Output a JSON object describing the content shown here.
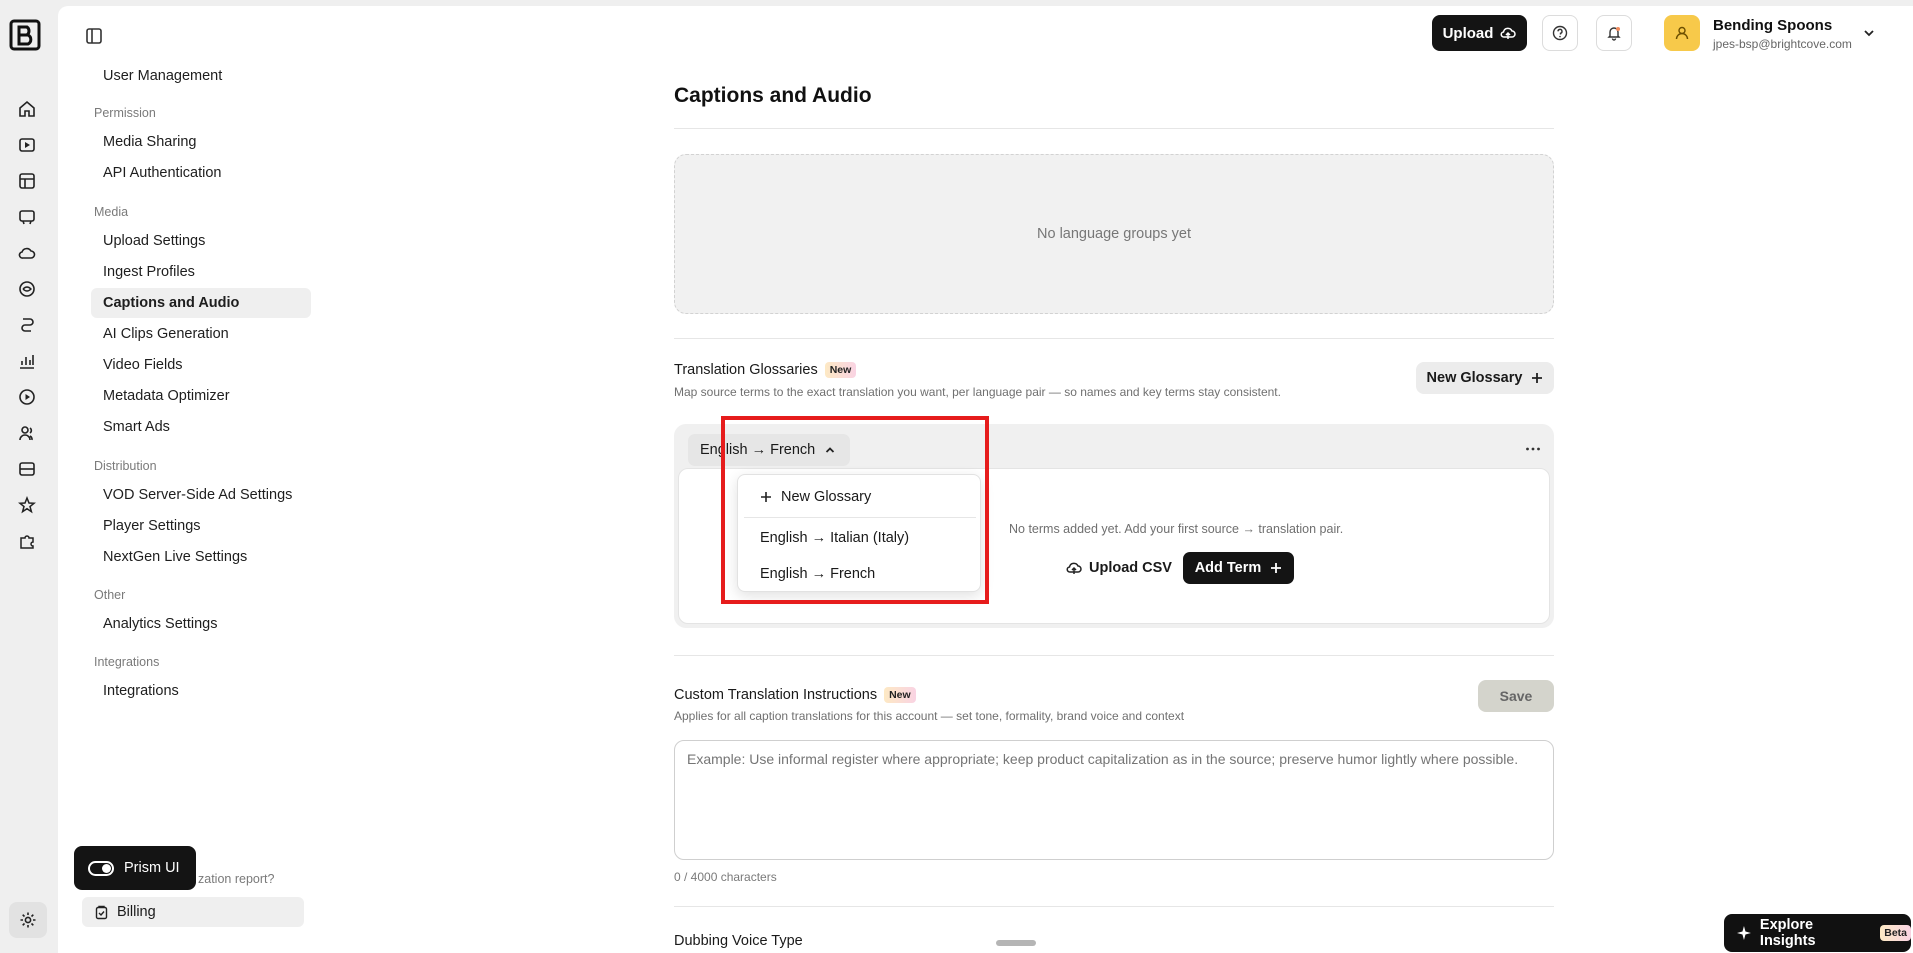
{
  "topbar": {
    "upload_label": "Upload",
    "account_name": "Bending Spoons",
    "account_email": "jpes-bsp@brightcove.com"
  },
  "settings_nav": {
    "partial_top_item": "User Management",
    "categories": {
      "permission": "Permission",
      "media": "Media",
      "distribution": "Distribution",
      "other": "Other",
      "integrations": "Integrations"
    },
    "items": {
      "media_sharing": "Media Sharing",
      "api_authentication": "API Authentication",
      "upload_settings": "Upload Settings",
      "ingest_profiles": "Ingest Profiles",
      "captions_and_audio": "Captions and Audio",
      "ai_clips_generation": "AI Clips Generation",
      "video_fields": "Video Fields",
      "metadata_optimizer": "Metadata Optimizer",
      "smart_ads": "Smart Ads",
      "vod_ssai": "VOD Server-Side Ad Settings",
      "player_settings": "Player Settings",
      "nextgen_live": "NextGen Live Settings",
      "analytics_settings": "Analytics Settings",
      "integrations": "Integrations",
      "billing": "Billing"
    },
    "partial_optimization_text": "zation report?"
  },
  "prism": {
    "label": "Prism UI"
  },
  "main": {
    "title": "Captions and Audio",
    "language_groups_empty": "No language groups yet",
    "glossaries": {
      "title": "Translation Glossaries",
      "badge": "New",
      "subtitle": "Map source terms to the exact translation you want, per language pair — so names and key terms stay consistent.",
      "new_glossary_label": "New Glossary",
      "selected_pair": "English → French",
      "no_terms": "No terms added yet. Add your first source → translation pair.",
      "upload_csv_label": "Upload CSV",
      "add_term_label": "Add Term",
      "dropdown": {
        "new_glossary": "New Glossary",
        "options": [
          "English → Italian (Italy)",
          "English → French"
        ]
      }
    },
    "instructions": {
      "title": "Custom Translation Instructions",
      "badge": "New",
      "subtitle": "Applies for all caption translations for this account — set tone, formality, brand voice and context",
      "save_label": "Save",
      "placeholder": "Example: Use informal register where appropriate; keep product capitalization as in the source; preserve humor lightly where possible.",
      "char_count": "0 / 4000 characters"
    },
    "dubbing": {
      "title": "Dubbing Voice Type"
    }
  },
  "explore": {
    "label": "Explore Insights",
    "badge": "Beta"
  },
  "colors": {
    "highlight": "#e61c1c",
    "dark": "#141414",
    "avatar": "#f7c94a"
  }
}
